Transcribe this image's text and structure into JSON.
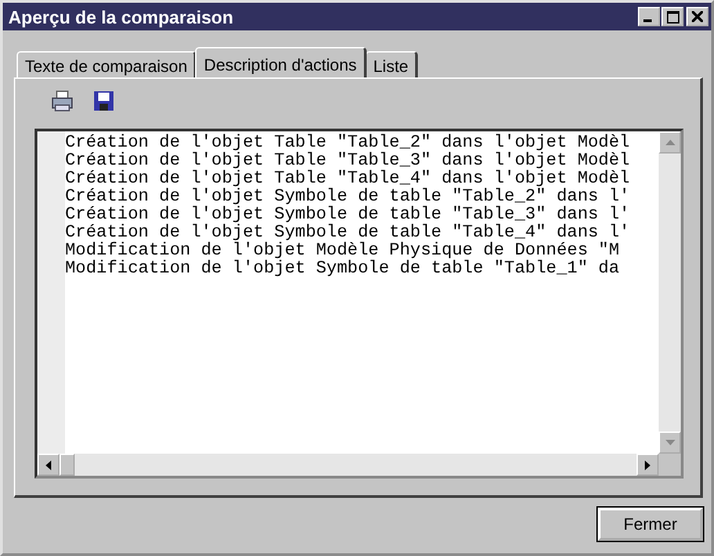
{
  "window": {
    "title": "Aperçu de la comparaison"
  },
  "tabs": [
    {
      "label": "Texte de comparaison",
      "selected": false
    },
    {
      "label": "Description d'actions",
      "selected": true
    },
    {
      "label": "Liste",
      "selected": false
    }
  ],
  "toolbar": [
    {
      "kind": "print"
    },
    {
      "kind": "save"
    }
  ],
  "lines": [
    "Création de l'objet Table \"Table_2\" dans l'objet Modèl",
    "Création de l'objet Table \"Table_3\" dans l'objet Modèl",
    "Création de l'objet Table \"Table_4\" dans l'objet Modèl",
    "Création de l'objet Symbole de table \"Table_2\" dans l'",
    "Création de l'objet Symbole de table \"Table_3\" dans l'",
    "Création de l'objet Symbole de table \"Table_4\" dans l'",
    "Modification de l'objet Modèle Physique de Données \"M",
    "Modification de l'objet Symbole de table \"Table_1\" da"
  ],
  "buttons": [
    "Fermer"
  ]
}
